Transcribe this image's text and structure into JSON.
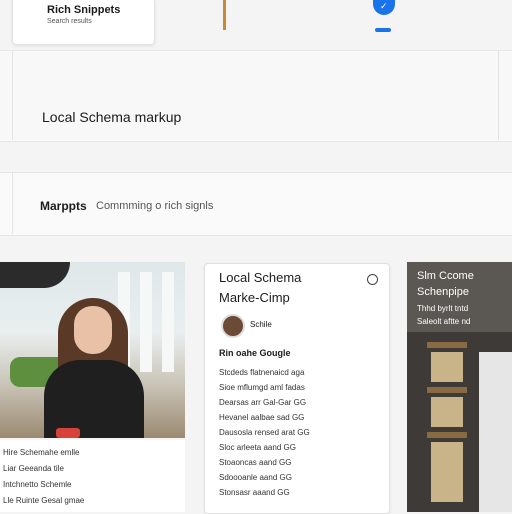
{
  "top_card": {
    "title": "Rich Snippets",
    "subtitle": "Search results"
  },
  "sections": {
    "local": "Local Schema markup",
    "marpts_title": "Marppts",
    "marpts_sub": "Commming o rich signls"
  },
  "photo_caption": [
    "Hire Schemahe emlle",
    "Liar Geeanda tile",
    "Intchnetto Schemle",
    "Lle Ruinte Gesal gmae"
  ],
  "middle_card": {
    "title_line1": "Local Schema",
    "title_line2": "Marke-Cimp",
    "author": "Schile",
    "subheading": "Rin oahe Gougle",
    "lines": [
      "Stcdeds flatnenaicd aga",
      "Sioe mflumgd aml fadas",
      "Dearsas arr Gal-Gar GG",
      "Hevanel aalbae sad GG",
      "Dausosla rensed arat GG",
      "Sloc arleeta aand GG",
      "Stoaoncas aand GG",
      "Sdoooanle aand GG",
      "Stonsasr aaand GG"
    ]
  },
  "right_card": {
    "title_line1": "Slm Ccome",
    "title_line2": "Schenpipe",
    "small1": "Thhd byrlt tntd",
    "small2": "Saleolt aftte nd"
  },
  "colors": {
    "accent_blue": "#1a73e8",
    "accent_orange": "#c78a2e"
  }
}
